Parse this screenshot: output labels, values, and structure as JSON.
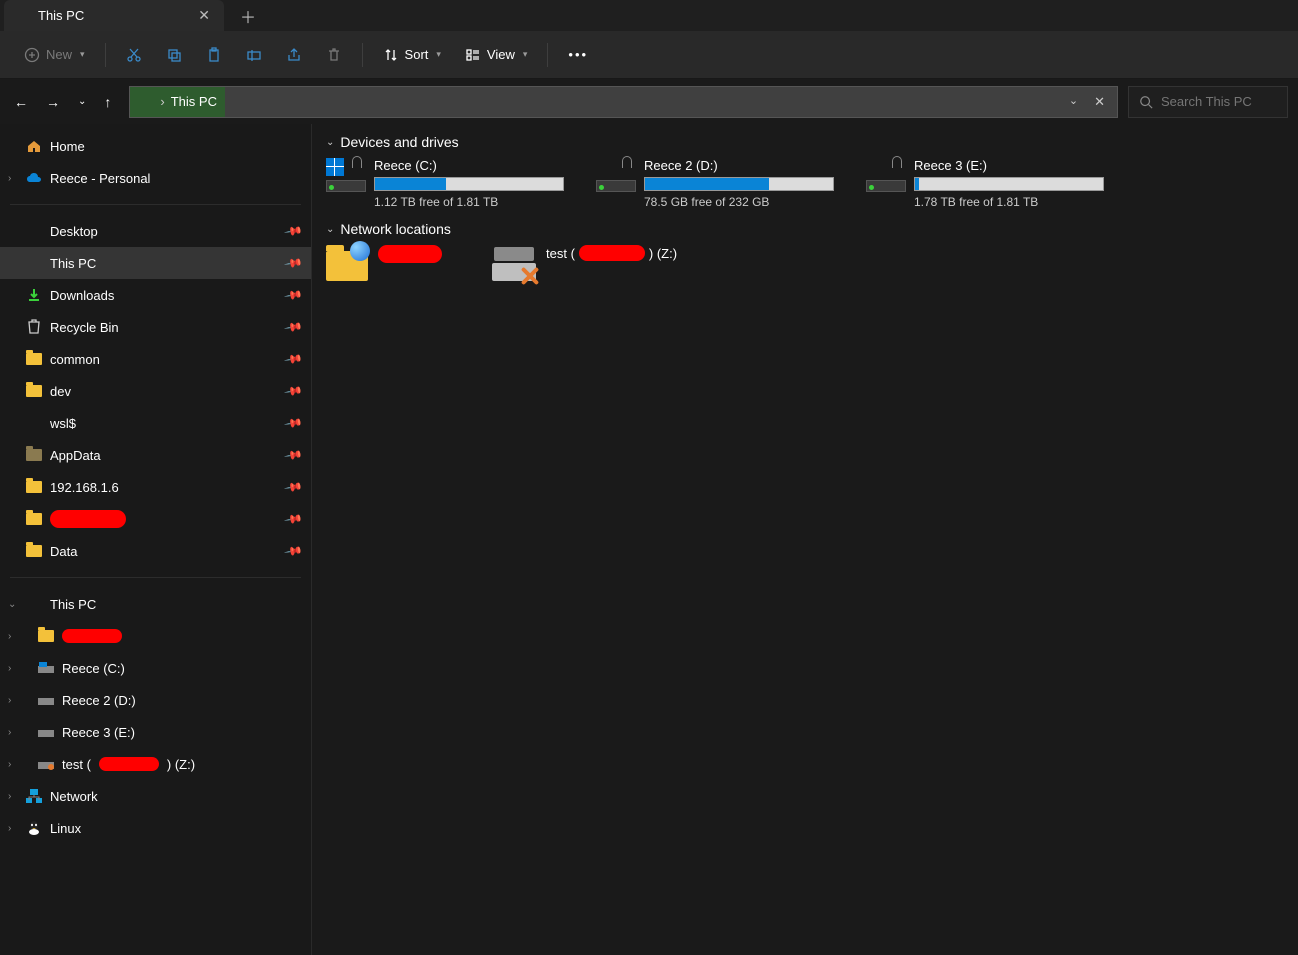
{
  "tab": {
    "title": "This PC"
  },
  "toolbar": {
    "new": "New",
    "sort": "Sort",
    "view": "View"
  },
  "address": {
    "crumb": "This PC",
    "search_placeholder": "Search This PC"
  },
  "sidebar": {
    "top": [
      {
        "label": "Home",
        "icon": "home"
      },
      {
        "label": "Reece - Personal",
        "icon": "onedrive",
        "expandable": true
      }
    ],
    "pinned": [
      {
        "label": "Desktop",
        "icon": "monitor",
        "pin": true
      },
      {
        "label": "This PC",
        "icon": "monitor",
        "pin": true,
        "selected": true
      },
      {
        "label": "Downloads",
        "icon": "download",
        "pin": true
      },
      {
        "label": "Recycle Bin",
        "icon": "bin",
        "pin": true
      },
      {
        "label": "common",
        "icon": "folder",
        "pin": true
      },
      {
        "label": "dev",
        "icon": "folder",
        "pin": true
      },
      {
        "label": "wsl$",
        "icon": "monitor",
        "pin": true
      },
      {
        "label": "AppData",
        "icon": "folder-dim",
        "pin": true
      },
      {
        "label": "192.168.1.6",
        "icon": "netfolder",
        "pin": true
      },
      {
        "label": "",
        "icon": "folder",
        "pin": true,
        "redacted": true
      },
      {
        "label": "Data",
        "icon": "folder",
        "pin": true
      }
    ],
    "tree": {
      "root": "This PC",
      "children": [
        {
          "label": "",
          "icon": "folder",
          "redacted": true
        },
        {
          "label": "Reece (C:)",
          "icon": "drive"
        },
        {
          "label": "Reece 2 (D:)",
          "icon": "drive"
        },
        {
          "label": "Reece 3 (E:)",
          "icon": "drive"
        },
        {
          "label_pre": "test (",
          "label_post": ") (Z:)",
          "icon": "netdrive",
          "redacted_mid": true
        }
      ],
      "after": [
        {
          "label": "Network",
          "icon": "network"
        },
        {
          "label": "Linux",
          "icon": "linux"
        }
      ]
    }
  },
  "content": {
    "sec1": "Devices and drives",
    "drives": [
      {
        "name": "Reece (C:)",
        "free": "1.12 TB free of 1.81 TB",
        "fill_pct": 38
      },
      {
        "name": "Reece 2 (D:)",
        "free": "78.5 GB free of 232 GB",
        "fill_pct": 66
      },
      {
        "name": "Reece 3 (E:)",
        "free": "1.78 TB free of 1.81 TB",
        "fill_pct": 2
      }
    ],
    "sec2": "Network locations",
    "net": {
      "item2_pre": "test (",
      "item2_post": ") (Z:)"
    }
  }
}
